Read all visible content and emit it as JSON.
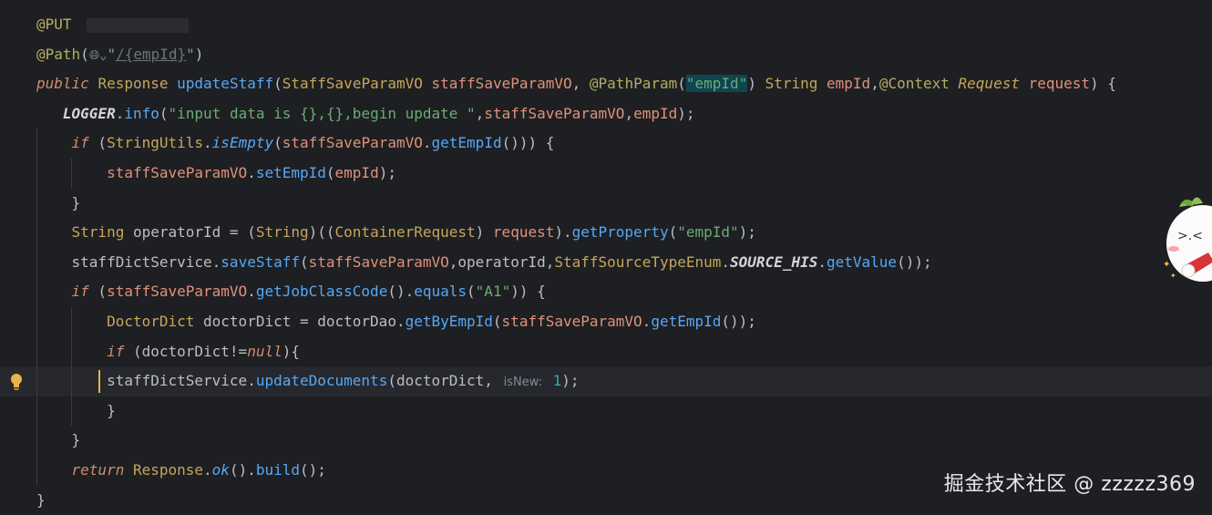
{
  "editor": {
    "lines": [
      {
        "tokens": [
          [
            "anno",
            "@PUT"
          ]
        ],
        "redacted": true
      },
      {
        "tokens": [
          [
            "anno",
            "@Path"
          ],
          [
            "plain",
            "("
          ],
          [
            "globe",
            "🌐︎⌄"
          ],
          [
            "str",
            "\""
          ],
          [
            "strurl",
            "/{empId}"
          ],
          [
            "str",
            "\""
          ],
          [
            "plain",
            ")"
          ]
        ]
      },
      {
        "tokens": [
          [
            "kwi",
            "public"
          ],
          [
            "plain",
            " "
          ],
          [
            "type",
            "Response"
          ],
          [
            "plain",
            " "
          ],
          [
            "meth",
            "updateStaff"
          ],
          [
            "plain",
            "("
          ],
          [
            "type",
            "StaffSaveParamVO"
          ],
          [
            "plain",
            " "
          ],
          [
            "var",
            "staffSaveParamVO"
          ],
          [
            "plain",
            ", "
          ],
          [
            "anno",
            "@PathParam"
          ],
          [
            "plain",
            "("
          ],
          [
            "hl",
            "\"empId\""
          ],
          [
            "plain",
            ") "
          ],
          [
            "type",
            "String"
          ],
          [
            "plain",
            " "
          ],
          [
            "var",
            "empId"
          ],
          [
            "plain",
            ","
          ],
          [
            "anno",
            "@Context"
          ],
          [
            "plain",
            " "
          ],
          [
            "typei",
            "Request"
          ],
          [
            "plain",
            " "
          ],
          [
            "var",
            "request"
          ],
          [
            "plain",
            ") {"
          ]
        ]
      },
      {
        "tokens": [
          [
            "plain",
            "   "
          ],
          [
            "constbi",
            "LOGGER"
          ],
          [
            "plain",
            "."
          ],
          [
            "meth",
            "info"
          ],
          [
            "plain",
            "("
          ],
          [
            "str",
            "\"input data is {},{},begin update \""
          ],
          [
            "plain",
            ","
          ],
          [
            "var",
            "staffSaveParamVO"
          ],
          [
            "plain",
            ","
          ],
          [
            "var",
            "empId"
          ],
          [
            "plain",
            ");"
          ]
        ]
      },
      {
        "tokens": [
          [
            "plain",
            "    "
          ],
          [
            "kwi",
            "if"
          ],
          [
            "plain",
            " ("
          ],
          [
            "type",
            "StringUtils"
          ],
          [
            "plain",
            "."
          ],
          [
            "methi",
            "isEmpty"
          ],
          [
            "plain",
            "("
          ],
          [
            "var",
            "staffSaveParamVO"
          ],
          [
            "plain",
            "."
          ],
          [
            "meth",
            "getEmpId"
          ],
          [
            "plain",
            "())) {"
          ]
        ]
      },
      {
        "tokens": [
          [
            "plain",
            "        "
          ],
          [
            "var",
            "staffSaveParamVO"
          ],
          [
            "plain",
            "."
          ],
          [
            "meth",
            "setEmpId"
          ],
          [
            "plain",
            "("
          ],
          [
            "var",
            "empId"
          ],
          [
            "plain",
            ");"
          ]
        ]
      },
      {
        "tokens": [
          [
            "plain",
            "    }"
          ]
        ]
      },
      {
        "tokens": [
          [
            "plain",
            "    "
          ],
          [
            "type",
            "String"
          ],
          [
            "plain",
            " operatorId = ("
          ],
          [
            "type",
            "String"
          ],
          [
            "plain",
            ")(("
          ],
          [
            "type",
            "ContainerRequest"
          ],
          [
            "plain",
            ") "
          ],
          [
            "var",
            "request"
          ],
          [
            "plain",
            ")."
          ],
          [
            "meth",
            "getProperty"
          ],
          [
            "plain",
            "("
          ],
          [
            "str",
            "\"empId\""
          ],
          [
            "plain",
            ");"
          ]
        ]
      },
      {
        "tokens": [
          [
            "plain",
            "    staffDictService."
          ],
          [
            "meth",
            "saveStaff"
          ],
          [
            "plain",
            "("
          ],
          [
            "var",
            "staffSaveParamVO"
          ],
          [
            "plain",
            ",operatorId,"
          ],
          [
            "type",
            "StaffSourceTypeEnum"
          ],
          [
            "plain",
            "."
          ],
          [
            "constbi",
            "SOURCE_HIS"
          ],
          [
            "plain",
            "."
          ],
          [
            "meth",
            "getValue"
          ],
          [
            "plain",
            "());"
          ]
        ]
      },
      {
        "tokens": [
          [
            "plain",
            "    "
          ],
          [
            "kwi",
            "if"
          ],
          [
            "plain",
            " ("
          ],
          [
            "var",
            "staffSaveParamVO"
          ],
          [
            "plain",
            "."
          ],
          [
            "meth",
            "getJobClassCode"
          ],
          [
            "plain",
            "()."
          ],
          [
            "meth",
            "equals"
          ],
          [
            "plain",
            "("
          ],
          [
            "str",
            "\"A1\""
          ],
          [
            "plain",
            ")) {"
          ]
        ]
      },
      {
        "tokens": [
          [
            "plain",
            "        "
          ],
          [
            "type",
            "DoctorDict"
          ],
          [
            "plain",
            " doctorDict = doctorDao."
          ],
          [
            "meth",
            "getByEmpId"
          ],
          [
            "plain",
            "("
          ],
          [
            "var",
            "staffSaveParamVO"
          ],
          [
            "plain",
            "."
          ],
          [
            "meth",
            "getEmpId"
          ],
          [
            "plain",
            "());"
          ]
        ]
      },
      {
        "tokens": [
          [
            "plain",
            "        "
          ],
          [
            "kwi",
            "if"
          ],
          [
            "plain",
            " (doctorDict!="
          ],
          [
            "kwi",
            "null"
          ],
          [
            "plain",
            "){"
          ]
        ]
      },
      {
        "tokens": [
          [
            "plain",
            "        staffDictService."
          ],
          [
            "meth",
            "updateDocuments"
          ],
          [
            "plain",
            "(doctorDict, "
          ],
          [
            "hint",
            "isNew:"
          ],
          [
            "plain",
            " "
          ],
          [
            "num",
            "1"
          ],
          [
            "plain",
            ");"
          ]
        ],
        "current": true
      },
      {
        "tokens": [
          [
            "plain",
            "        }"
          ]
        ]
      },
      {
        "tokens": [
          [
            "plain",
            "    }"
          ]
        ]
      },
      {
        "tokens": [
          [
            "plain",
            "    "
          ],
          [
            "kwi",
            "return"
          ],
          [
            "plain",
            " "
          ],
          [
            "type",
            "Response"
          ],
          [
            "plain",
            "."
          ],
          [
            "methi",
            "ok"
          ],
          [
            "plain",
            "()."
          ],
          [
            "meth",
            "build"
          ],
          [
            "plain",
            "();"
          ]
        ]
      },
      {
        "tokens": [
          [
            "plain",
            "}"
          ]
        ]
      }
    ]
  },
  "watermark": "掘金技术社区 @ zzzzz369",
  "colors": {
    "background": "#1e1f22",
    "current_line": "#26282e",
    "caret": "#e4b54a",
    "bulb": "#e4b54a"
  }
}
